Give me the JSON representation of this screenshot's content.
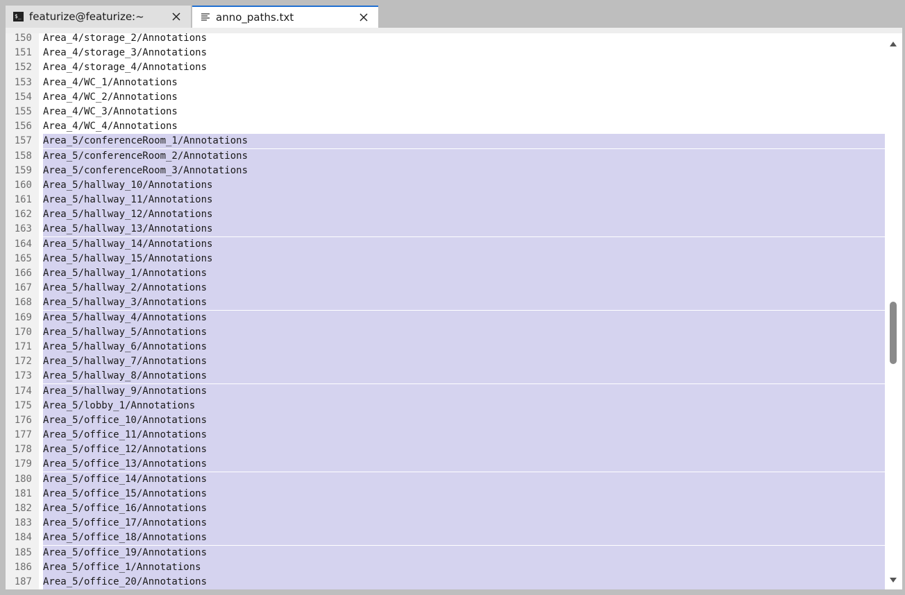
{
  "tabs": [
    {
      "title": "featurize@featurize:~",
      "active": false,
      "icon": "terminal-icon"
    },
    {
      "title": "anno_paths.txt",
      "active": true,
      "icon": "text-file-icon"
    }
  ],
  "terminal_icon_glyph": "$_",
  "colors": {
    "accent": "#1f6fd1",
    "selection": "#d5d3ef",
    "gutter": "#f1f1f1",
    "chrome": "#bebebe"
  },
  "editor": {
    "lines": [
      {
        "num": "150",
        "text": "Area_4/storage_2/Annotations",
        "selected": false
      },
      {
        "num": "151",
        "text": "Area_4/storage_3/Annotations",
        "selected": false
      },
      {
        "num": "152",
        "text": "Area_4/storage_4/Annotations",
        "selected": false
      },
      {
        "num": "153",
        "text": "Area_4/WC_1/Annotations",
        "selected": false
      },
      {
        "num": "154",
        "text": "Area_4/WC_2/Annotations",
        "selected": false
      },
      {
        "num": "155",
        "text": "Area_4/WC_3/Annotations",
        "selected": false
      },
      {
        "num": "156",
        "text": "Area_4/WC_4/Annotations",
        "selected": false
      },
      {
        "num": "157",
        "text": "Area_5/conferenceRoom_1/Annotations",
        "selected": true
      },
      {
        "num": "158",
        "text": "Area_5/conferenceRoom_2/Annotations",
        "selected": true
      },
      {
        "num": "159",
        "text": "Area_5/conferenceRoom_3/Annotations",
        "selected": true
      },
      {
        "num": "160",
        "text": "Area_5/hallway_10/Annotations",
        "selected": true
      },
      {
        "num": "161",
        "text": "Area_5/hallway_11/Annotations",
        "selected": true
      },
      {
        "num": "162",
        "text": "Area_5/hallway_12/Annotations",
        "selected": true
      },
      {
        "num": "163",
        "text": "Area_5/hallway_13/Annotations",
        "selected": true
      },
      {
        "num": "164",
        "text": "Area_5/hallway_14/Annotations",
        "selected": true
      },
      {
        "num": "165",
        "text": "Area_5/hallway_15/Annotations",
        "selected": true
      },
      {
        "num": "166",
        "text": "Area_5/hallway_1/Annotations",
        "selected": true
      },
      {
        "num": "167",
        "text": "Area_5/hallway_2/Annotations",
        "selected": true
      },
      {
        "num": "168",
        "text": "Area_5/hallway_3/Annotations",
        "selected": true
      },
      {
        "num": "169",
        "text": "Area_5/hallway_4/Annotations",
        "selected": true
      },
      {
        "num": "170",
        "text": "Area_5/hallway_5/Annotations",
        "selected": true
      },
      {
        "num": "171",
        "text": "Area_5/hallway_6/Annotations",
        "selected": true
      },
      {
        "num": "172",
        "text": "Area_5/hallway_7/Annotations",
        "selected": true
      },
      {
        "num": "173",
        "text": "Area_5/hallway_8/Annotations",
        "selected": true
      },
      {
        "num": "174",
        "text": "Area_5/hallway_9/Annotations",
        "selected": true
      },
      {
        "num": "175",
        "text": "Area_5/lobby_1/Annotations",
        "selected": true
      },
      {
        "num": "176",
        "text": "Area_5/office_10/Annotations",
        "selected": true
      },
      {
        "num": "177",
        "text": "Area_5/office_11/Annotations",
        "selected": true
      },
      {
        "num": "178",
        "text": "Area_5/office_12/Annotations",
        "selected": true
      },
      {
        "num": "179",
        "text": "Area_5/office_13/Annotations",
        "selected": true
      },
      {
        "num": "180",
        "text": "Area_5/office_14/Annotations",
        "selected": true
      },
      {
        "num": "181",
        "text": "Area_5/office_15/Annotations",
        "selected": true
      },
      {
        "num": "182",
        "text": "Area_5/office_16/Annotations",
        "selected": true
      },
      {
        "num": "183",
        "text": "Area_5/office_17/Annotations",
        "selected": true
      },
      {
        "num": "184",
        "text": "Area_5/office_18/Annotations",
        "selected": true
      },
      {
        "num": "185",
        "text": "Area_5/office_19/Annotations",
        "selected": true
      },
      {
        "num": "186",
        "text": "Area_5/office_1/Annotations",
        "selected": true
      },
      {
        "num": "187",
        "text": "Area_5/office_20/Annotations",
        "selected": true
      }
    ]
  }
}
